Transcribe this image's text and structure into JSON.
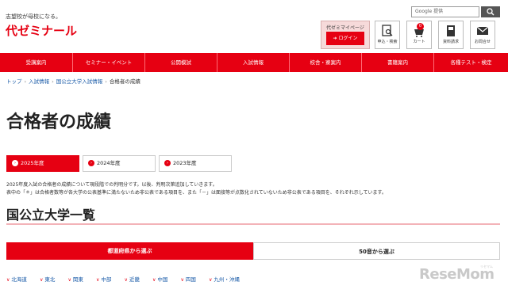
{
  "header": {
    "tagline": "志望校が母校になる。",
    "logo": "代ゼミナール",
    "search_placeholder": "Google 提供",
    "mypage_title": "代ゼミマイページ",
    "login_label": "ログイン",
    "icons": [
      {
        "label": "申込・検索",
        "icon": "search-doc-icon"
      },
      {
        "label": "カート",
        "icon": "cart-icon",
        "badge": "0"
      },
      {
        "label": "資料請求",
        "icon": "document-icon"
      },
      {
        "label": "お問合せ",
        "icon": "mail-icon"
      }
    ]
  },
  "nav": [
    {
      "label": "受講案内"
    },
    {
      "label": "セミナー・イベント"
    },
    {
      "label": "公開模試"
    },
    {
      "label": "入試情報"
    },
    {
      "label": "校舎・寮案内"
    },
    {
      "label": "書籍案内"
    },
    {
      "label": "各種テスト・検定"
    }
  ],
  "breadcrumb": [
    "トップ",
    "入試情報",
    "国公立大学入試情報",
    "合格者の成績"
  ],
  "page_title": "合格者の成績",
  "year_tabs": [
    {
      "label": "2025年度",
      "active": true
    },
    {
      "label": "2024年度",
      "active": false
    },
    {
      "label": "2023年度",
      "active": false
    }
  ],
  "intro": [
    "2025年度入試の合格者の成績について現段階での判明分です。以後、判明次第追加していきます。",
    "表中の「＊」は合格者数等が各大学の公表基準に満たないため非公表である項目を、また「－」は面接等が点数化されていないため非公表である項目を、それぞれ示しています。"
  ],
  "section_title": "国公立大学一覧",
  "selector_tabs": [
    {
      "label": "都道府県から選ぶ",
      "active": true
    },
    {
      "label": "50音から選ぶ",
      "active": false
    }
  ],
  "regions": [
    "北海道",
    "東北",
    "関東",
    "中部",
    "近畿",
    "中国",
    "四国",
    "九州・沖縄"
  ],
  "watermark": {
    "text": "ReseMom",
    "sub": "リセマム"
  },
  "colors": {
    "brand": "#e60012",
    "link": "#1a5ba8"
  }
}
